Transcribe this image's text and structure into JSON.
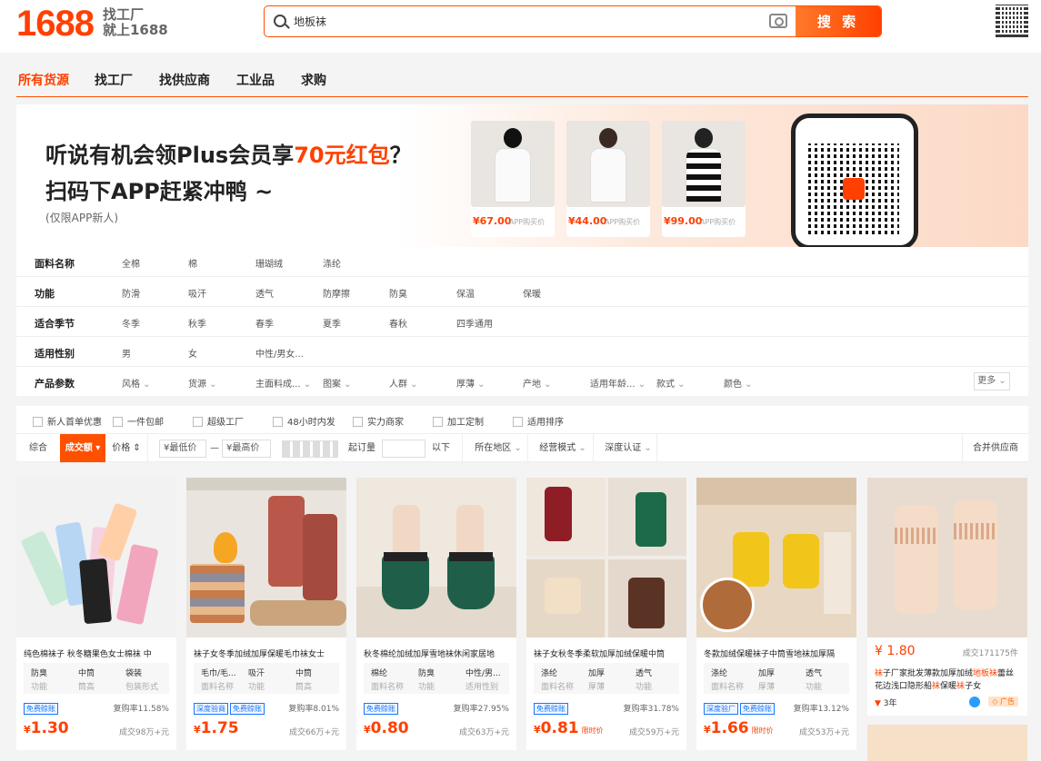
{
  "header": {
    "logo": "1688",
    "slogan_line1": "找工厂",
    "slogan_line2": "就上1688",
    "search_value": "地板袜",
    "search_button": "搜 索"
  },
  "nav": {
    "items": [
      "所有货源",
      "找工厂",
      "找供应商",
      "工业品",
      "求购"
    ]
  },
  "banner": {
    "line1_prefix": "听说有机会领Plus会员享",
    "line1_highlight": "70元红包",
    "line1_suffix": "？",
    "line2": "扫码下APP赶紧冲鸭 ~",
    "line3": "(仅限APP新人)",
    "products": [
      {
        "price": "¥67.00",
        "label": "APP购买价"
      },
      {
        "price": "¥44.00",
        "label": "APP购买价"
      },
      {
        "price": "¥99.00",
        "label": "APP购买价"
      }
    ]
  },
  "filters": {
    "rows": [
      {
        "label": "面料名称",
        "options": [
          "全棉",
          "棉",
          "珊瑚绒",
          "涤纶"
        ]
      },
      {
        "label": "功能",
        "options": [
          "防滑",
          "吸汗",
          "透气",
          "防摩擦",
          "防臭",
          "保温",
          "保暖"
        ]
      },
      {
        "label": "适合季节",
        "options": [
          "冬季",
          "秋季",
          "春季",
          "夏季",
          "春秋",
          "四季通用"
        ]
      },
      {
        "label": "适用性别",
        "options": [
          "男",
          "女",
          "中性/男女..."
        ]
      },
      {
        "label": "产品参数",
        "options": [
          "风格",
          "货源",
          "主面料成...",
          "图案",
          "人群",
          "厚薄",
          "产地",
          "适用年龄...",
          "款式",
          "颜色"
        ]
      }
    ],
    "more": "更多"
  },
  "checks": [
    "新人首单优惠",
    "一件包邮",
    "超级工厂",
    "48小时内发",
    "实力商家",
    "加工定制",
    "适用排序"
  ],
  "sort": {
    "items": [
      "综合",
      "成交额",
      "价格"
    ],
    "min_price": "¥最低价",
    "dash": "—",
    "max_price": "¥最高价",
    "qty_label": "起订量",
    "qty_unit": "以下",
    "region": "所在地区",
    "model": "经营模式",
    "cert": "深度认证",
    "merge": "合并供应商"
  },
  "products": [
    {
      "title": "纯色棉袜子 秋冬糖果色女士棉袜 中",
      "attrs": [
        {
          "v": "防臭",
          "k": "功能"
        },
        {
          "v": "中筒",
          "k": "筒高"
        },
        {
          "v": "袋装",
          "k": "包装形式"
        }
      ],
      "tags": [
        "免费赊账"
      ],
      "rebuy": "复购率11.58%",
      "price": "1.30",
      "limit": "",
      "sold": "成交98万+元"
    },
    {
      "title": "袜子女冬季加绒加厚保暖毛巾袜女士",
      "attrs": [
        {
          "v": "毛巾/毛...",
          "k": "面料名称"
        },
        {
          "v": "吸汗",
          "k": "功能"
        },
        {
          "v": "中筒",
          "k": "筒高"
        }
      ],
      "tags": [
        "深度验商",
        "免费赊账"
      ],
      "rebuy": "复购率8.01%",
      "price": "1.75",
      "limit": "",
      "sold": "成交66万+元"
    },
    {
      "title": "秋冬棉纶加绒加厚雪地袜休闲家居地",
      "attrs": [
        {
          "v": "棉纶",
          "k": "面料名称"
        },
        {
          "v": "防臭",
          "k": "功能"
        },
        {
          "v": "中性/男...",
          "k": "适用性别"
        }
      ],
      "tags": [
        "免费赊账"
      ],
      "rebuy": "复购率27.95%",
      "price": "0.80",
      "limit": "",
      "sold": "成交63万+元"
    },
    {
      "title": "袜子女秋冬季柔软加厚加绒保暖中筒",
      "attrs": [
        {
          "v": "涤纶",
          "k": "面料名称"
        },
        {
          "v": "加厚",
          "k": "厚薄"
        },
        {
          "v": "透气",
          "k": "功能"
        }
      ],
      "tags": [
        "免费赊账"
      ],
      "rebuy": "复购率31.78%",
      "price": "0.81",
      "limit": "限时价",
      "sold": "成交59万+元"
    },
    {
      "title": "冬款加绒保暖袜子中筒雪地袜加厚隔",
      "attrs": [
        {
          "v": "涤纶",
          "k": "面料名称"
        },
        {
          "v": "加厚",
          "k": "厚薄"
        },
        {
          "v": "透气",
          "k": "功能"
        }
      ],
      "tags": [
        "深度验厂",
        "免费赊账"
      ],
      "rebuy": "复购率13.12%",
      "price": "1.66",
      "limit": "限时价",
      "sold": "成交53万+元"
    }
  ],
  "ad_card": {
    "price": "¥ 1.80",
    "sold": "成交171175件",
    "title_parts": [
      "袜",
      "子厂家批发薄款加厚加绒",
      "地板袜",
      "蕾丝花边浅口隐形船",
      "袜",
      "保暖",
      "袜",
      "子女"
    ],
    "years": "3年",
    "badge": "广告"
  },
  "colors": {
    "accent": "#ff4000",
    "tag_blue": "#1677ff"
  }
}
